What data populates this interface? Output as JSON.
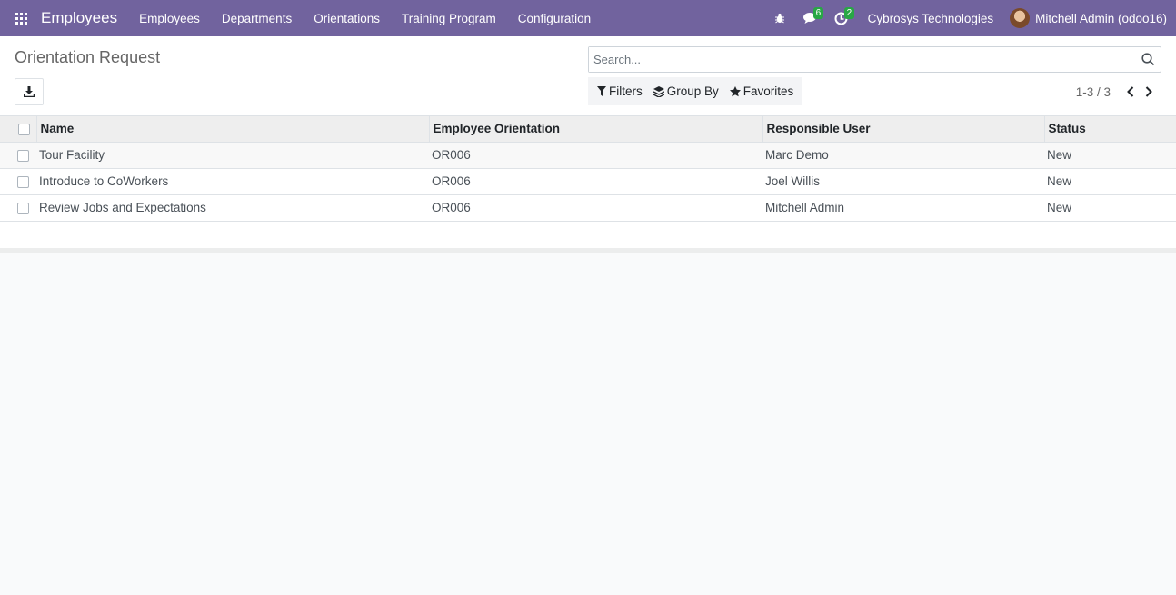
{
  "navbar": {
    "app_name": "Employees",
    "menu": [
      "Employees",
      "Departments",
      "Orientations",
      "Training Program",
      "Configuration"
    ],
    "messages_count": "6",
    "activities_count": "2",
    "company": "Cybrosys Technologies",
    "user": "Mitchell Admin (odoo16)",
    "accent_color": "#71639e",
    "badge_color": "#28a745"
  },
  "control": {
    "title": "Orientation Request",
    "search_placeholder": "Search...",
    "filters_label": "Filters",
    "group_by_label": "Group By",
    "favorites_label": "Favorites",
    "pager": "1-3 / 3"
  },
  "table": {
    "columns": [
      "Name",
      "Employee Orientation",
      "Responsible User",
      "Status"
    ],
    "rows": [
      {
        "name": "Tour Facility",
        "orientation": "OR006",
        "user": "Marc Demo",
        "status": "New"
      },
      {
        "name": "Introduce to CoWorkers",
        "orientation": "OR006",
        "user": "Joel Willis",
        "status": "New"
      },
      {
        "name": "Review Jobs and Expectations",
        "orientation": "OR006",
        "user": "Mitchell Admin",
        "status": "New"
      }
    ]
  }
}
